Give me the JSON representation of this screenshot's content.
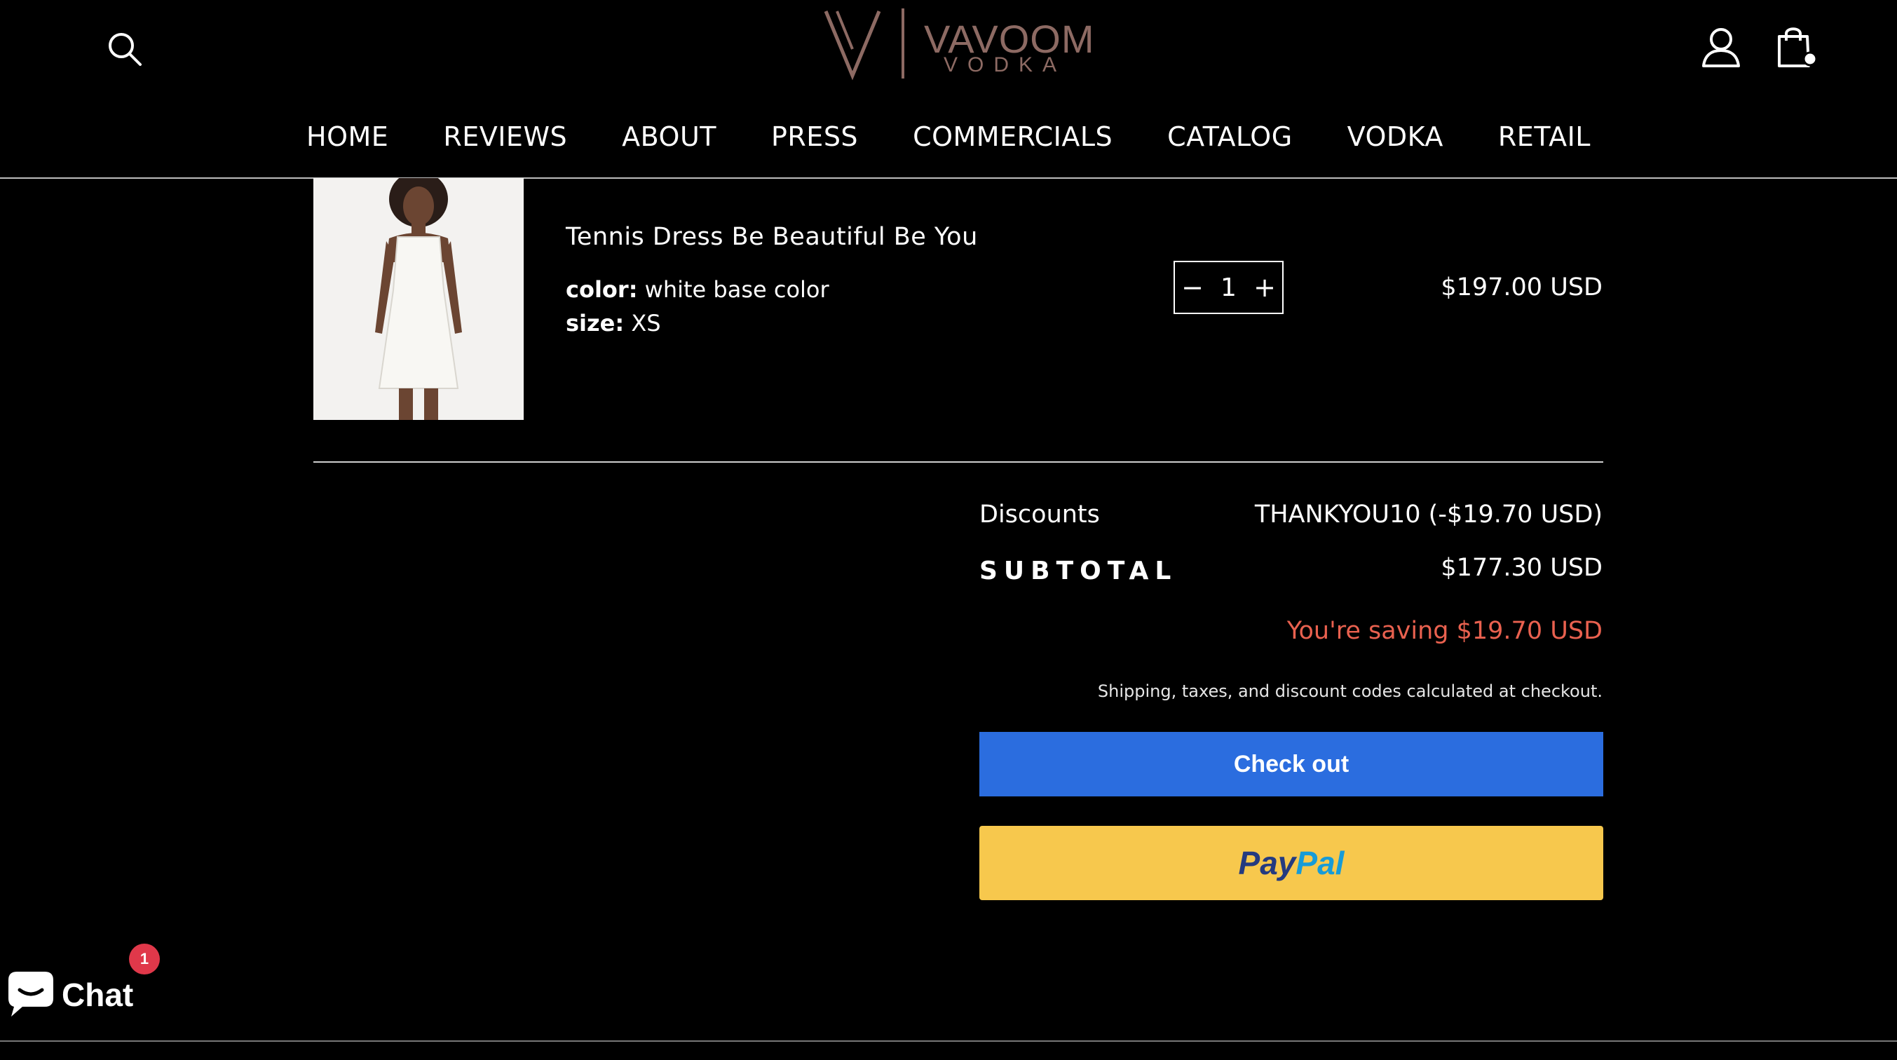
{
  "logo": {
    "wordmark": "VAVOOM",
    "sub": "VODKA"
  },
  "nav": {
    "items": [
      "HOME",
      "REVIEWS",
      "ABOUT",
      "PRESS",
      "COMMERCIALS",
      "CATALOG",
      "VODKA",
      "RETAIL"
    ]
  },
  "cart": {
    "item": {
      "title": "Tennis Dress Be Beautiful Be You",
      "color_label": "color:",
      "color_value": "white base color",
      "size_label": "size:",
      "size_value": "XS",
      "quantity": "1",
      "decrement_symbol": "−",
      "increment_symbol": "+",
      "price": "$197.00 USD"
    },
    "summary": {
      "discounts_label": "Discounts",
      "discounts_value": "THANKYOU10 (-$19.70 USD)",
      "subtotal_label": "SUBTOTAL",
      "subtotal_value": "$177.30 USD",
      "saving_text": "You're saving $19.70 USD",
      "note": "Shipping, taxes, and discount codes calculated at checkout.",
      "checkout_label": "Check out",
      "paypal_left": "Pay",
      "paypal_right": "Pal"
    }
  },
  "chat": {
    "label": "Chat",
    "badge": "1"
  },
  "colors": {
    "background": "#000000",
    "brand": "#8d6a63",
    "checkout": "#2b6ddf",
    "paypal": "#f7c84d",
    "saving": "#e9614f",
    "badge": "#e0384a"
  },
  "icons": [
    "search-icon",
    "account-icon",
    "cart-icon",
    "chat-bubble-icon"
  ]
}
